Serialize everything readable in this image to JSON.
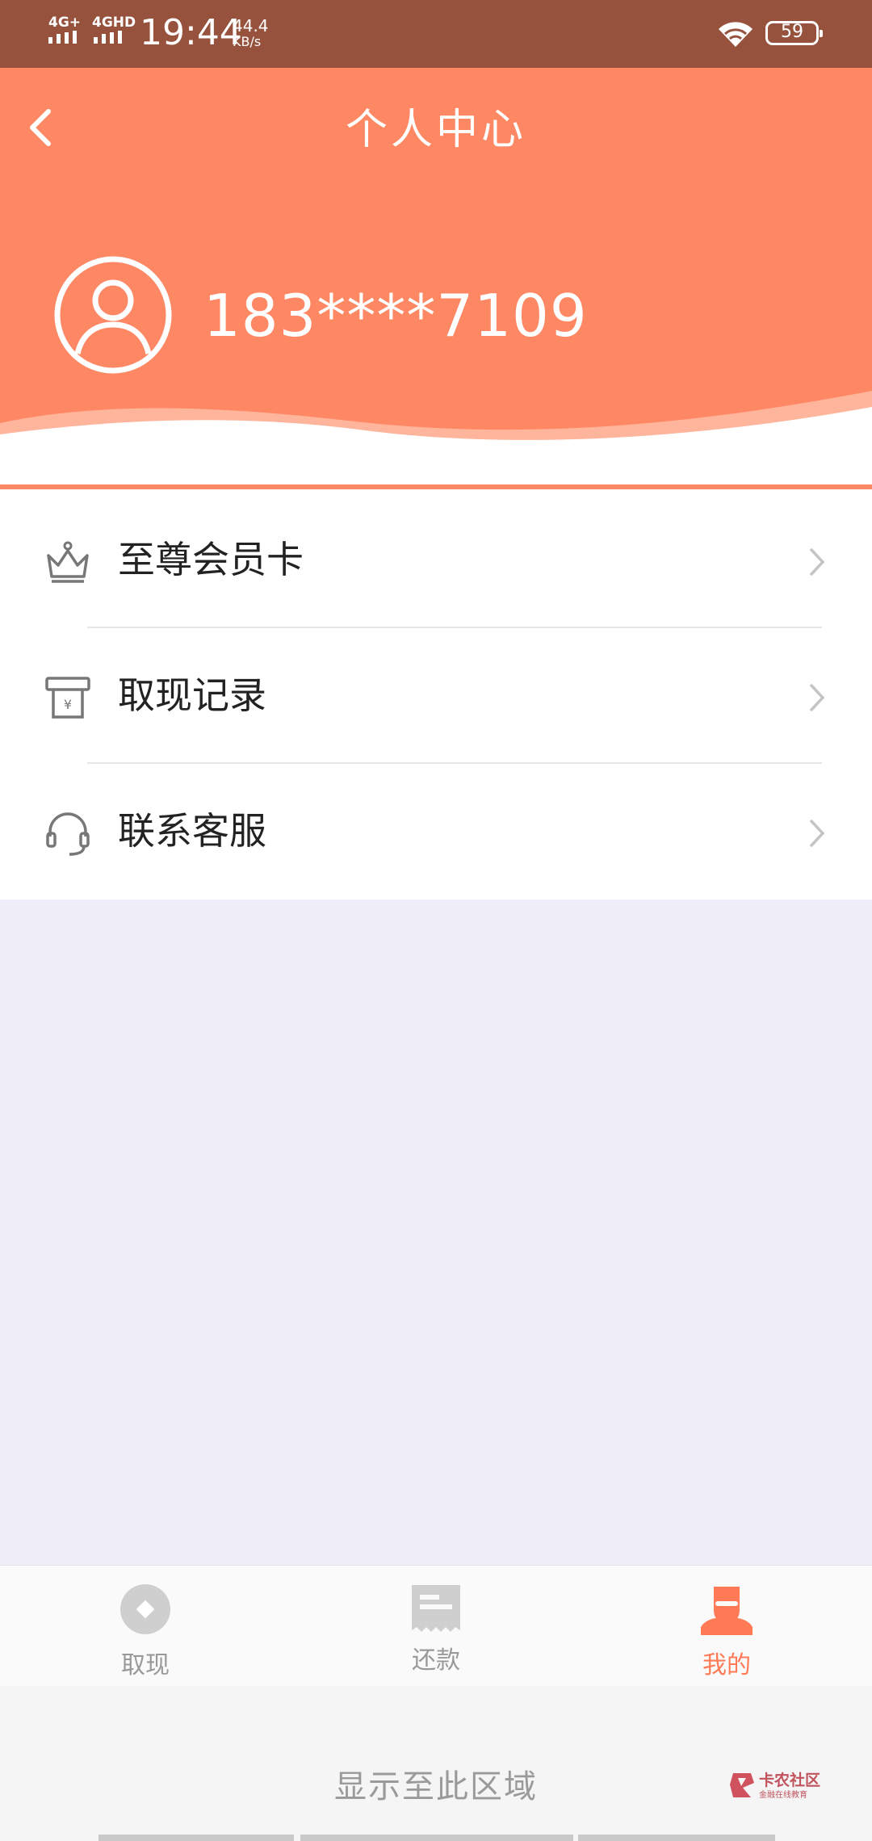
{
  "status_bar": {
    "network_1": "4G+",
    "network_2": "4GHD",
    "time": "19:44",
    "speed_value": "44.4",
    "speed_unit": "KB/s",
    "battery": "59"
  },
  "header": {
    "title": "个人中心",
    "phone": "183****7109"
  },
  "menu": {
    "items": [
      {
        "label": "至尊会员卡",
        "icon": "crown-icon"
      },
      {
        "label": "取现记录",
        "icon": "receipt-icon"
      },
      {
        "label": "联系客服",
        "icon": "headset-icon"
      }
    ]
  },
  "bottom_nav": {
    "items": [
      {
        "label": "取现",
        "icon": "withdraw-icon",
        "active": false
      },
      {
        "label": "还款",
        "icon": "repay-icon",
        "active": false
      },
      {
        "label": "我的",
        "icon": "profile-icon",
        "active": true
      }
    ]
  },
  "bottom_area": {
    "text": "显示至此区域"
  },
  "watermark": {
    "title": "卡农社区",
    "subtitle": "金融在线教育"
  },
  "colors": {
    "status_bar": "#96523d",
    "header": "#ff8864",
    "accent": "#ff7a55",
    "background": "#efeef8"
  }
}
